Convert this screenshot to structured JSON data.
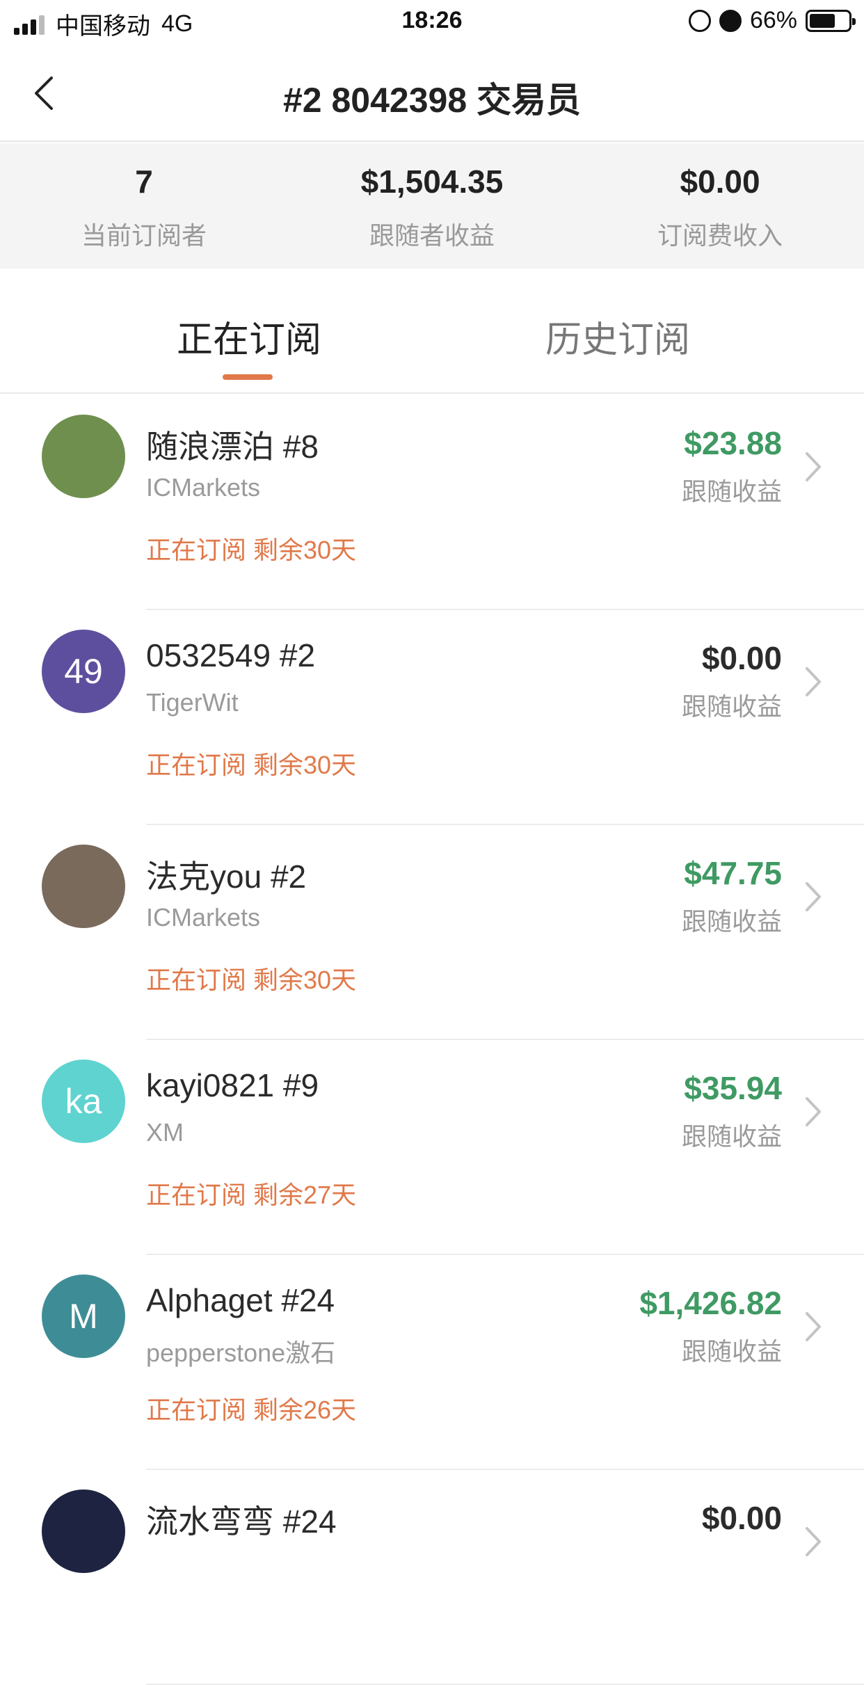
{
  "status_bar": {
    "carrier": "中国移动",
    "network": "4G",
    "time": "18:26",
    "battery": "66%",
    "battery_level": 0.66
  },
  "header": {
    "title": "#2 8042398 交易员"
  },
  "stats": [
    {
      "value": "7",
      "label": "当前订阅者"
    },
    {
      "value": "$1,504.35",
      "label": "跟随者收益"
    },
    {
      "value": "$0.00",
      "label": "订阅费收入"
    }
  ],
  "tabs": [
    {
      "label": "正在订阅",
      "active": true
    },
    {
      "label": "历史订阅",
      "active": false
    }
  ],
  "subscribers": [
    {
      "name": "随浪漂泊 #8",
      "broker": "ICMarkets",
      "status": "正在订阅 剩余30天",
      "earnings": "$23.88",
      "earnings_label": "跟随收益",
      "avatar_text": "",
      "avatar_color": "#6f8f4e",
      "positive": true
    },
    {
      "name": "0532549 #2",
      "broker": "TigerWit",
      "status": "正在订阅 剩余30天",
      "earnings": "$0.00",
      "earnings_label": "跟随收益",
      "avatar_text": "49",
      "avatar_color": "#5e4f9e",
      "positive": false
    },
    {
      "name": "法克you #2",
      "broker": "ICMarkets",
      "status": "正在订阅 剩余30天",
      "earnings": "$47.75",
      "earnings_label": "跟随收益",
      "avatar_text": "",
      "avatar_color": "#7a6a5c",
      "positive": true
    },
    {
      "name": "kayi0821 #9",
      "broker": "XM",
      "status": "正在订阅 剩余27天",
      "earnings": "$35.94",
      "earnings_label": "跟随收益",
      "avatar_text": "ka",
      "avatar_color": "#5fd3cf",
      "positive": true
    },
    {
      "name": "Alphaget #24",
      "broker": "pepperstone激石",
      "status": "正在订阅 剩余26天",
      "earnings": "$1,426.82",
      "earnings_label": "跟随收益",
      "avatar_text": "M",
      "avatar_color": "#3e8d96",
      "positive": true
    },
    {
      "name": "流水弯弯 #24",
      "broker": "",
      "status": "",
      "earnings": "$0.00",
      "earnings_label": "",
      "avatar_text": "",
      "avatar_color": "#1d2340",
      "positive": false
    }
  ]
}
